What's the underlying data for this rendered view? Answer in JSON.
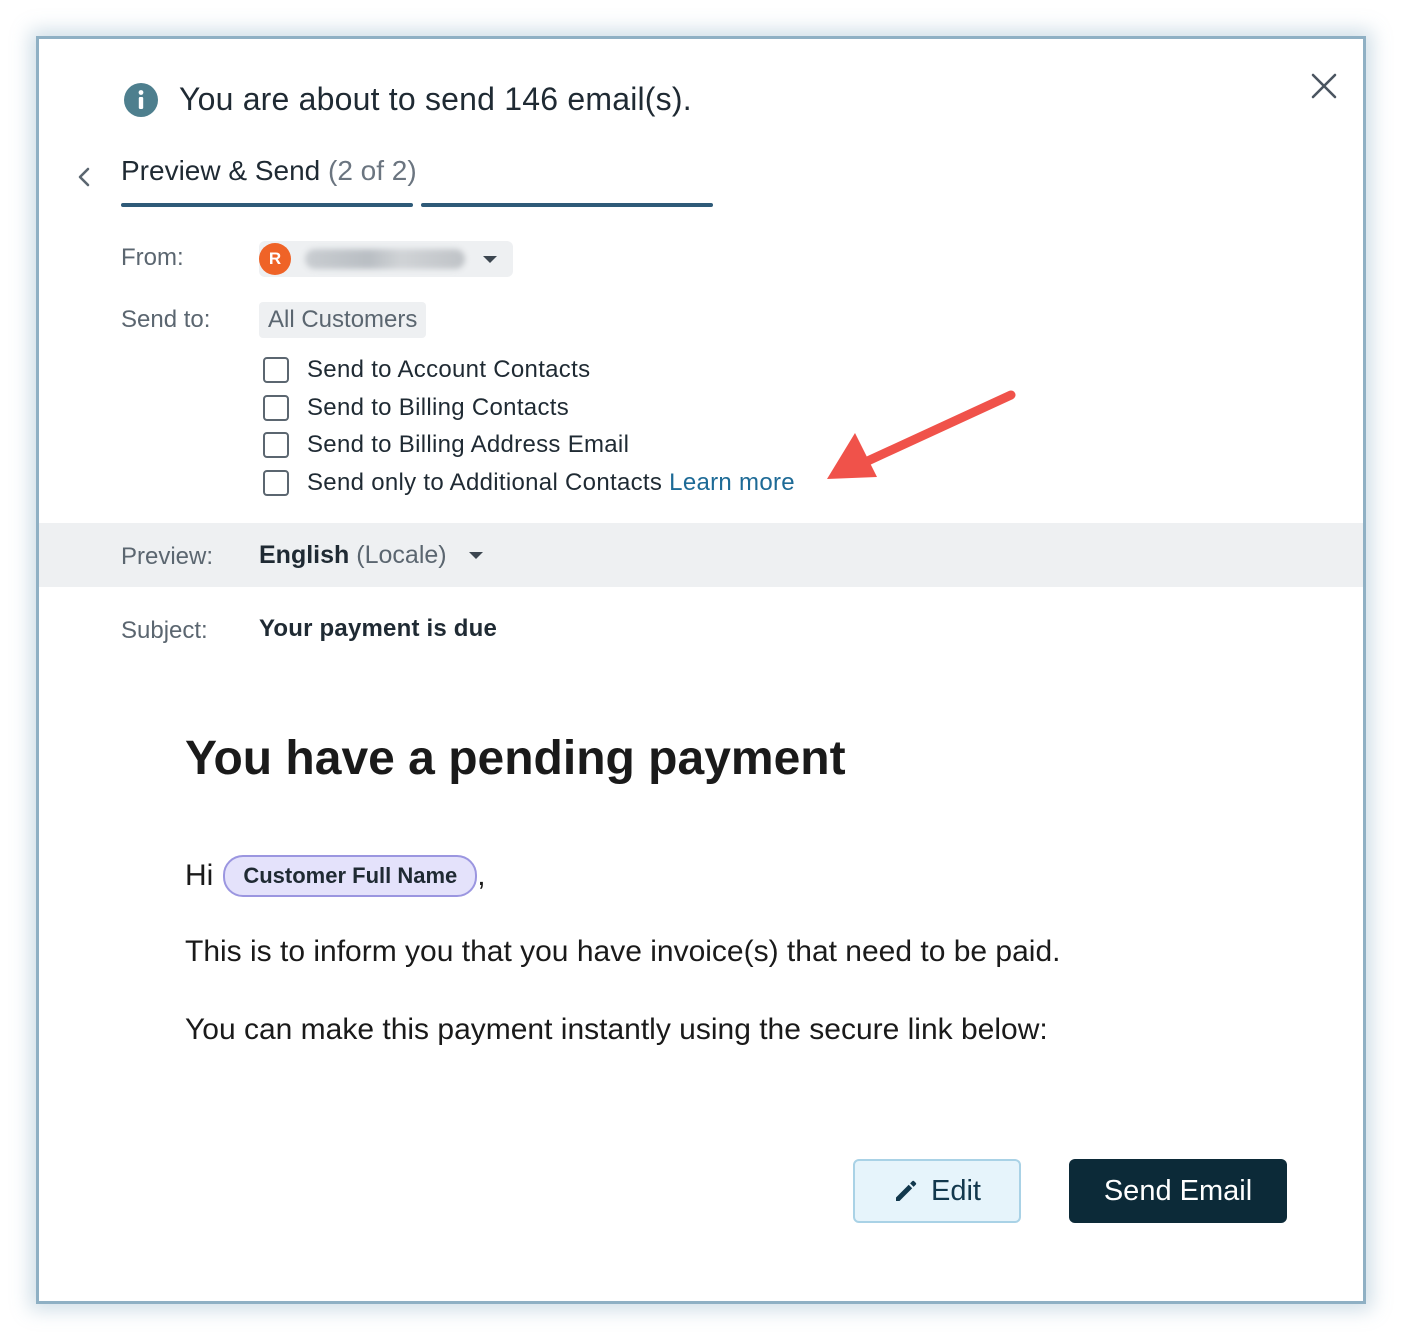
{
  "header": {
    "message": "You are about to send 146 email(s).",
    "info_icon": "info-circle-icon",
    "close_icon": "close-icon"
  },
  "step": {
    "title": "Preview & Send",
    "count": "(2 of 2)",
    "back_icon": "chevron-left-icon"
  },
  "from": {
    "label": "From:",
    "avatar_initial": "R",
    "avatar_color": "#ef6327"
  },
  "send_to": {
    "label": "Send to:",
    "audience": "All Customers",
    "options": [
      {
        "label": "Send to Account Contacts",
        "checked": false
      },
      {
        "label": "Send to Billing Contacts",
        "checked": false
      },
      {
        "label": "Send to Billing Address Email",
        "checked": false
      },
      {
        "label": "Send only to Additional Contacts",
        "checked": false
      }
    ],
    "learn_more": "Learn more"
  },
  "preview": {
    "label": "Preview:",
    "language": "English",
    "locale_suffix": "(Locale)"
  },
  "subject": {
    "label": "Subject:",
    "value": "Your payment is due"
  },
  "email": {
    "heading": "You have a pending payment",
    "greeting": "Hi",
    "merge_field": "Customer Full Name",
    "greeting_suffix": ",",
    "line1": "This is to inform you that you have invoice(s) that need to be paid.",
    "line2": "You can make this payment instantly using the secure link below:"
  },
  "actions": {
    "edit": "Edit",
    "edit_icon": "pencil-icon",
    "send": "Send Email"
  },
  "colors": {
    "accent": "#2e5a78",
    "link": "#1d6a96",
    "primary_button": "#0c2a38",
    "annotation_arrow": "#f0524a"
  }
}
